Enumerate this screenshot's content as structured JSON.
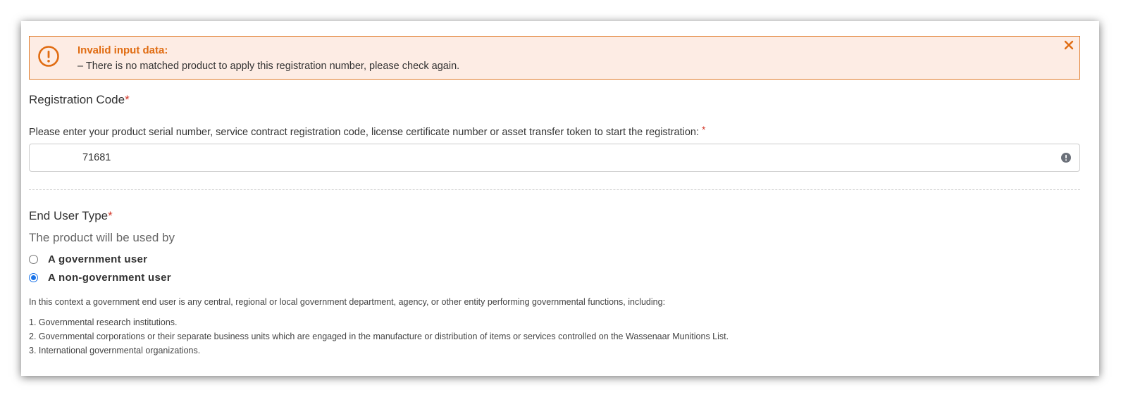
{
  "alert": {
    "title": "Invalid input data:",
    "message": "–  There is no matched product to apply this registration number, please check again.",
    "close_glyph": "✕",
    "color": "#e06c12",
    "background": "#fdece4"
  },
  "registration": {
    "title": "Registration Code",
    "required_mark": "*",
    "prompt": "Please enter your product serial number, service contract registration code, license certificate number or asset transfer token to start the registration:",
    "prompt_required_mark": "*",
    "input_value": "71681"
  },
  "end_user": {
    "title": "End User Type",
    "required_mark": "*",
    "subtitle": "The product will be used by",
    "options": [
      {
        "label": "A government user",
        "checked": false
      },
      {
        "label": "A non-government user",
        "checked": true
      }
    ],
    "context_text": "In this context a government end user is any central, regional or local government department, agency, or other entity performing governmental functions, including:",
    "list": [
      "1. Governmental research institutions.",
      "2. Governmental corporations or their separate business units which are engaged in the manufacture or distribution of items or services controlled on the Wassenaar Munitions List.",
      "3. International governmental organizations."
    ]
  }
}
